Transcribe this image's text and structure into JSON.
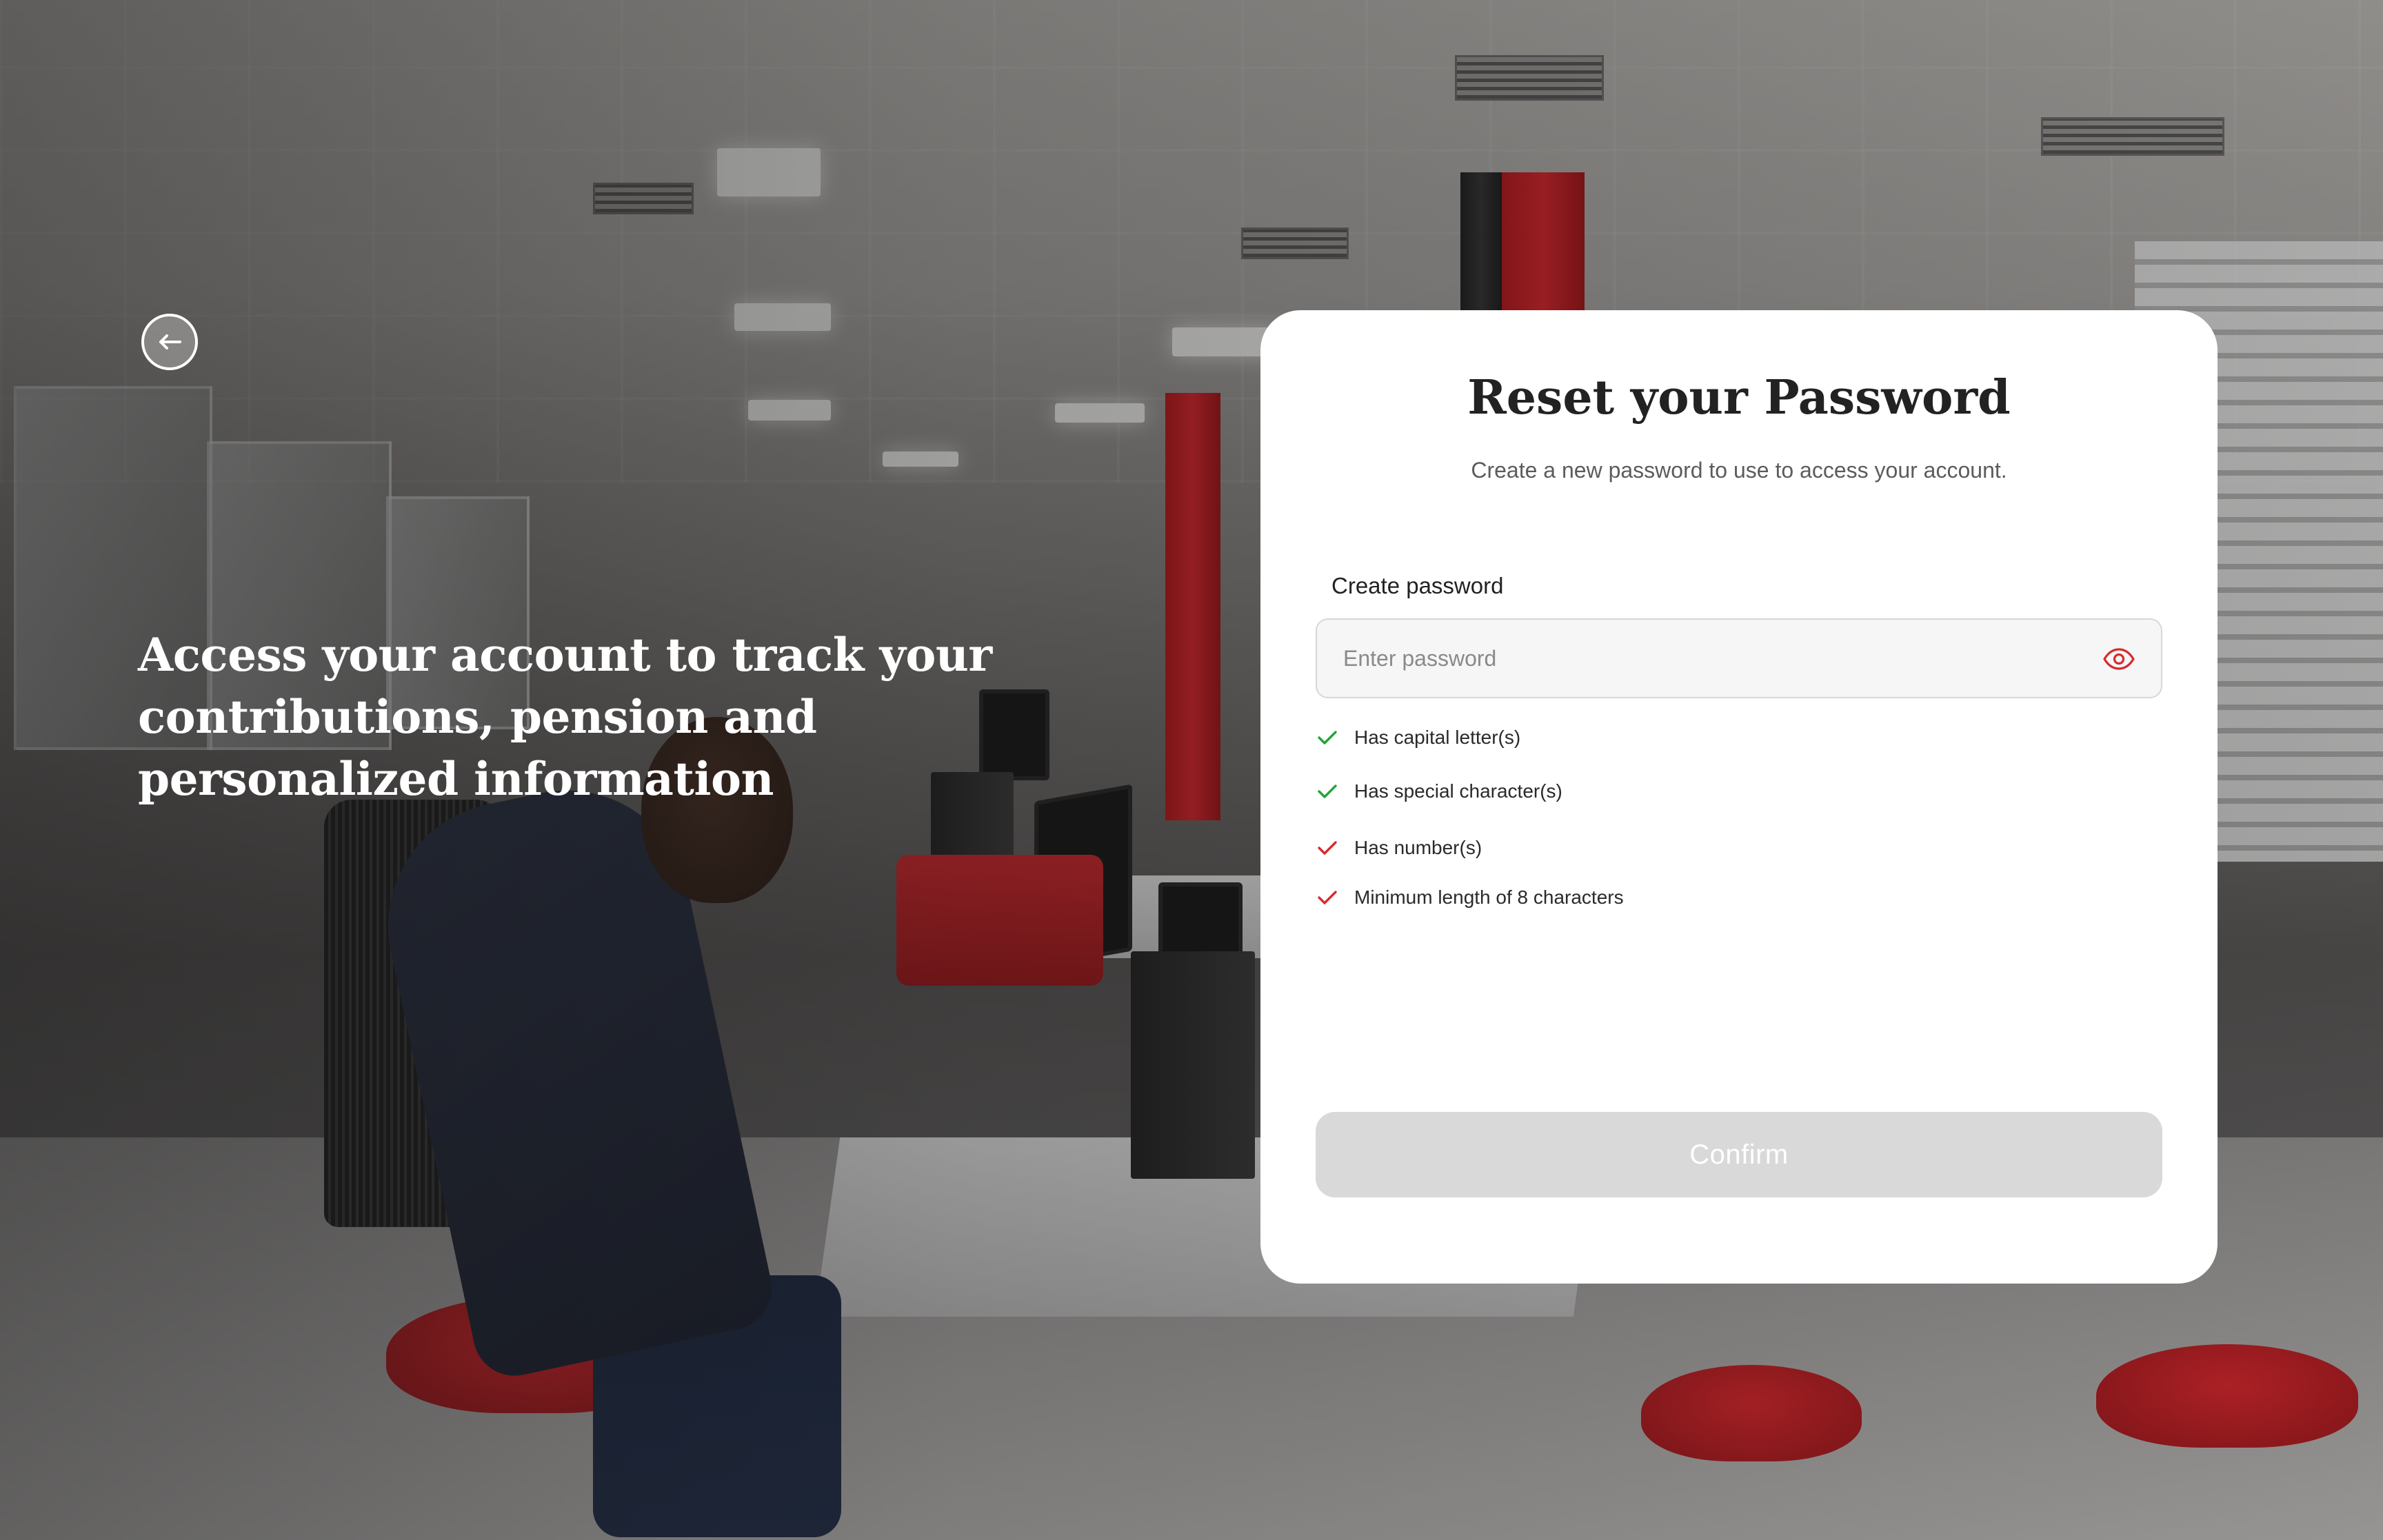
{
  "hero": {
    "text": "Access your account to track your contributions, pension and personalized information"
  },
  "back_button": {
    "icon": "arrow-left-icon"
  },
  "reset_card": {
    "title": "Reset your Password",
    "subtitle": "Create a new password to use to access your account.",
    "password_field": {
      "label": "Create password",
      "placeholder": "Enter password",
      "value": "",
      "toggle_icon": "eye-icon"
    },
    "requirements": [
      {
        "label": "Has capital letter(s)",
        "met": true,
        "icon": "check-icon"
      },
      {
        "label": "Has special character(s)",
        "met": true,
        "icon": "check-icon"
      },
      {
        "label": "Has number(s)",
        "met": false,
        "icon": "check-icon"
      },
      {
        "label": "Minimum length of 8 characters",
        "met": false,
        "icon": "check-icon"
      }
    ],
    "confirm_label": "Confirm",
    "confirm_enabled": false
  },
  "colors": {
    "accent": "#D72B2F",
    "requirement_met": "#22A33A",
    "requirement_unmet": "#D72B2F",
    "button_disabled": "#D9D9D9",
    "title_text": "#222222",
    "card_background": "#FFFFFF"
  }
}
